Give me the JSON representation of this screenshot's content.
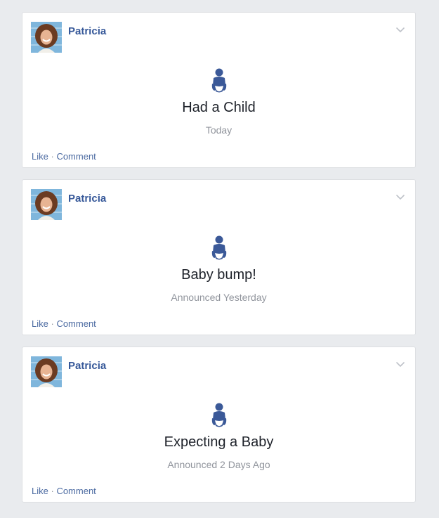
{
  "colors": {
    "page_bg": "#e9ebee",
    "card_bg": "#ffffff",
    "author": "#365899",
    "icon": "#3b5998",
    "link": "#4b6aa1",
    "muted": "#90949c"
  },
  "icons": {
    "avatar": "profile-photo",
    "menu": "chevron-down-icon",
    "event": "baby-icon"
  },
  "posts": [
    {
      "author": "Patricia",
      "event_title": "Had a Child",
      "event_date": "Today",
      "actions": {
        "like": "Like",
        "separator": "·",
        "comment": "Comment"
      }
    },
    {
      "author": "Patricia",
      "event_title": "Baby bump!",
      "event_date": "Announced Yesterday",
      "actions": {
        "like": "Like",
        "separator": "·",
        "comment": "Comment"
      }
    },
    {
      "author": "Patricia",
      "event_title": "Expecting a Baby",
      "event_date": "Announced 2 Days Ago",
      "actions": {
        "like": "Like",
        "separator": "·",
        "comment": "Comment"
      }
    }
  ]
}
